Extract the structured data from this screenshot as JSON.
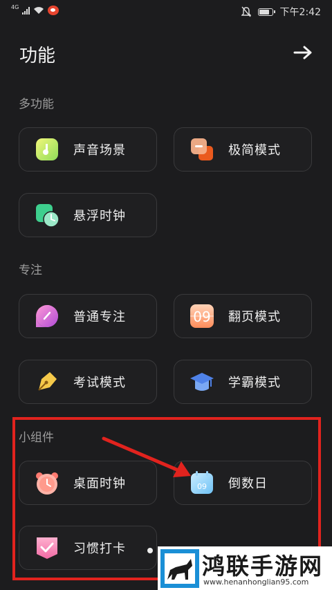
{
  "status_bar": {
    "network": "4G",
    "time": "下午2:42"
  },
  "header": {
    "title": "功能"
  },
  "sections": {
    "multi": {
      "label": "多功能",
      "items": [
        {
          "label": "声音场景"
        },
        {
          "label": "极简模式"
        },
        {
          "label": "悬浮时钟"
        }
      ]
    },
    "focus": {
      "label": "专注",
      "items": [
        {
          "label": "普通专注"
        },
        {
          "label": "翻页模式"
        },
        {
          "label": "考试模式"
        },
        {
          "label": "学霸模式"
        }
      ]
    },
    "widgets": {
      "label": "小组件",
      "items": [
        {
          "label": "桌面时钟"
        },
        {
          "label": "倒数日"
        },
        {
          "label": "习惯打卡"
        }
      ]
    }
  },
  "icons": {
    "flip_text": "09",
    "countdown_text": "09"
  },
  "watermark": {
    "title": "鸿联手游网",
    "url": "www.henanhonglian95.com"
  },
  "colors": {
    "background": "#1c1c1e",
    "card_border": "#3a3a3c",
    "annotation_red": "#e1231e"
  }
}
